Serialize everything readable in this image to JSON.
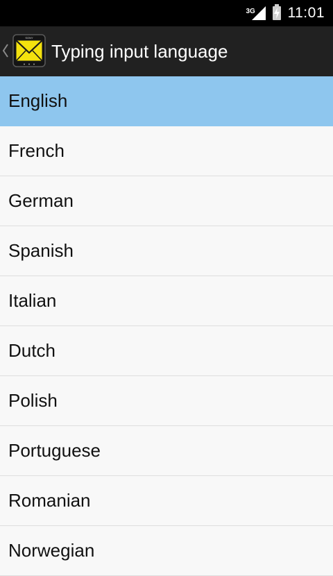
{
  "status_bar": {
    "network_type": "3G",
    "time": "11:01",
    "icons": [
      "signal-icon",
      "battery-charging-icon"
    ]
  },
  "action_bar": {
    "title": "Typing input language",
    "icons": [
      "up-caret-icon",
      "sony-envelope-app-icon"
    ],
    "background": "#212121"
  },
  "language_list": {
    "selected": "English",
    "selected_color": "#8ec6ee",
    "items": [
      {
        "label": "English"
      },
      {
        "label": "French"
      },
      {
        "label": "German"
      },
      {
        "label": "Spanish"
      },
      {
        "label": "Italian"
      },
      {
        "label": "Dutch"
      },
      {
        "label": "Polish"
      },
      {
        "label": "Portuguese"
      },
      {
        "label": "Romanian"
      },
      {
        "label": "Norwegian"
      }
    ]
  }
}
